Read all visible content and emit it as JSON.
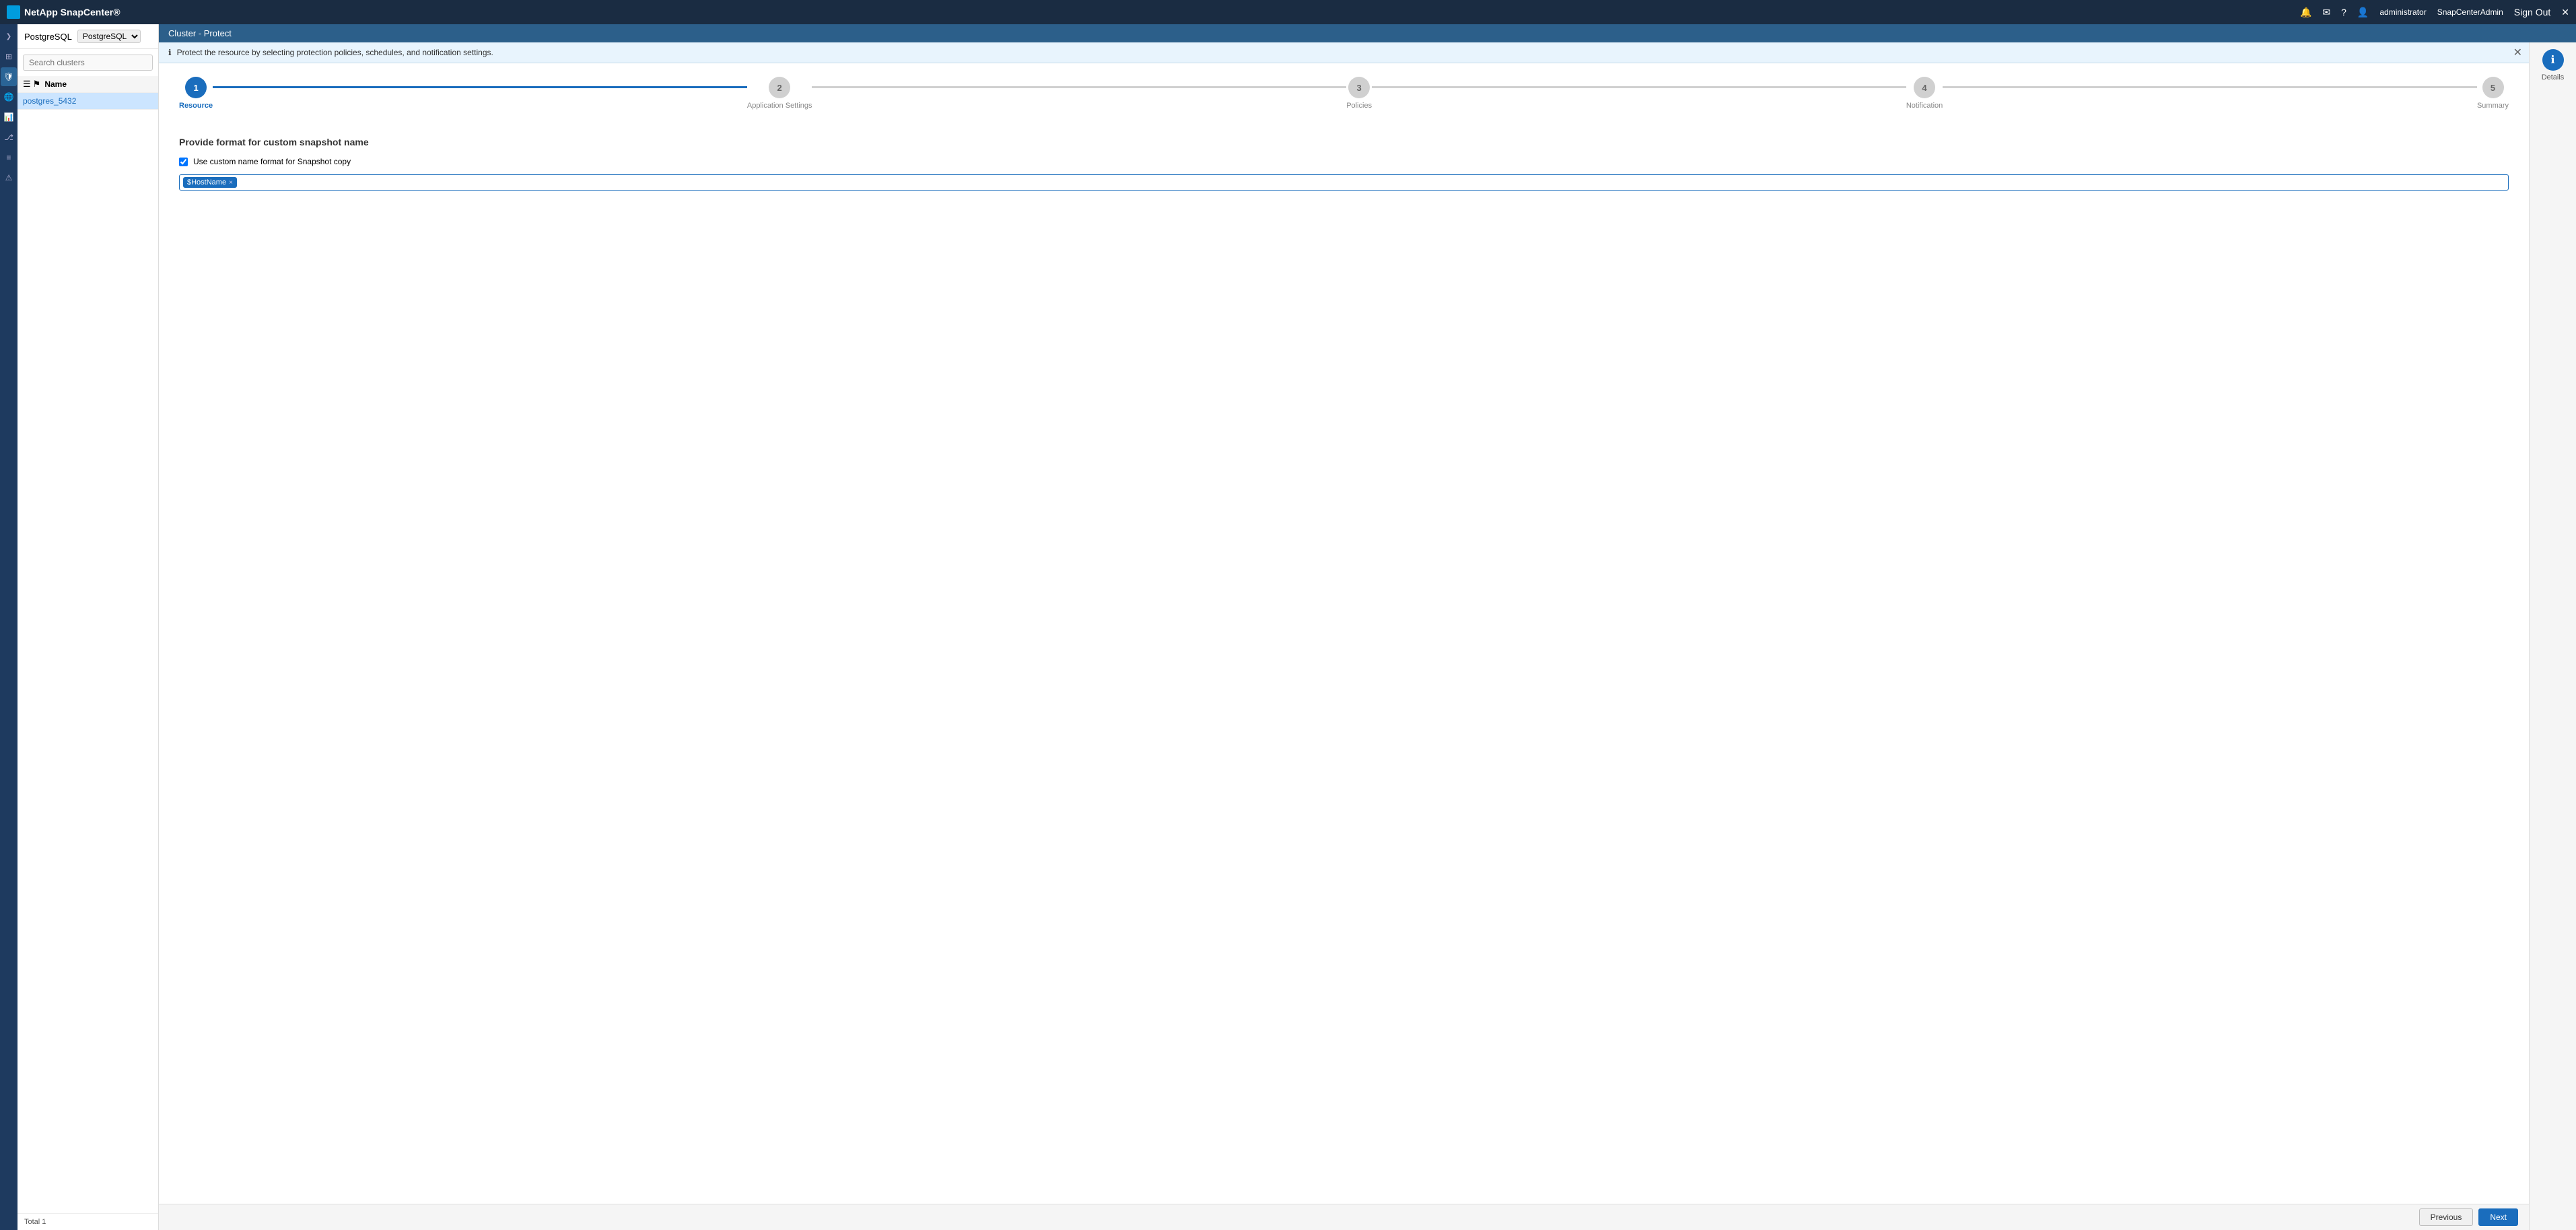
{
  "app": {
    "logo_text": "NetApp SnapCenter®",
    "title": "Cluster - Protect",
    "breadcrumb": "Cluster - Protect"
  },
  "topbar": {
    "notification_icon": "🔔",
    "message_icon": "✉",
    "help_icon": "?",
    "user_icon": "👤",
    "user_name": "administrator",
    "admin_name": "SnapCenterAdmin",
    "signout_label": "Sign Out",
    "close_icon": "✕"
  },
  "sidebar": {
    "icons": [
      {
        "name": "expand",
        "symbol": "❯",
        "active": false
      },
      {
        "name": "dashboard",
        "symbol": "⊞",
        "active": false
      },
      {
        "name": "protection",
        "symbol": "🛡",
        "active": true
      },
      {
        "name": "globe",
        "symbol": "🌐",
        "active": false
      },
      {
        "name": "reports",
        "symbol": "📊",
        "active": false
      },
      {
        "name": "topology",
        "symbol": "⎇",
        "active": false
      },
      {
        "name": "logs",
        "symbol": "≡",
        "active": false
      },
      {
        "name": "alerts",
        "symbol": "⚠",
        "active": false
      }
    ]
  },
  "resource_panel": {
    "db_label": "PostgreSQL",
    "dropdown_symbol": "▾",
    "search_placeholder": "Search clusters",
    "columns": [
      {
        "key": "icons",
        "label": ""
      },
      {
        "key": "name",
        "label": "Name"
      }
    ],
    "rows": [
      {
        "name": "postgres_5432"
      }
    ],
    "footer_label": "Total 1"
  },
  "info_bar": {
    "icon": "ℹ",
    "message": "Protect the resource by selecting protection policies, schedules, and notification settings."
  },
  "wizard": {
    "steps": [
      {
        "number": "1",
        "label": "Resource",
        "active": true
      },
      {
        "number": "2",
        "label": "Application Settings",
        "active": false
      },
      {
        "number": "3",
        "label": "Policies",
        "active": false
      },
      {
        "number": "4",
        "label": "Notification",
        "active": false
      },
      {
        "number": "5",
        "label": "Summary",
        "active": false
      }
    ],
    "form": {
      "title": "Provide format for custom snapshot name",
      "checkbox_label": "Use custom name format for Snapshot copy",
      "checkbox_checked": true,
      "token_value": "$HostName",
      "token_close": "×"
    }
  },
  "footer": {
    "previous_label": "Previous",
    "next_label": "Next"
  },
  "details_panel": {
    "icon": "ℹ",
    "label": "Details"
  }
}
